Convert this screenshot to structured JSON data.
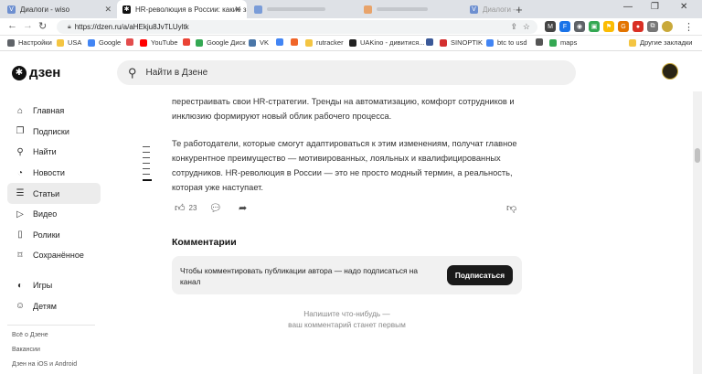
{
  "browser": {
    "tabs": [
      {
        "title": "Диалоги - wiso",
        "fav_color": "#6d8fd0",
        "fav_glyph": "V",
        "active": false
      },
      {
        "title": "HR-революция в России: какие з",
        "fav_color": "#111111",
        "fav_glyph": "✱",
        "active": true
      },
      {
        "title": "",
        "fav_color": "#7a9cd8",
        "fav_glyph": "",
        "active": false
      },
      {
        "title": "",
        "fav_color": "#e8a36a",
        "fav_glyph": "",
        "active": false
      },
      {
        "title": "Диалоги - wiso",
        "fav_color": "#6d8fd0",
        "fav_glyph": "V",
        "active": false
      }
    ],
    "url": "https://dzen.ru/a/aHEkju8JvTLUyltk",
    "bookmarks": [
      {
        "label": "Настройки",
        "color": "#5f6368"
      },
      {
        "label": "USA",
        "color": "#f4c542"
      },
      {
        "label": "Google",
        "color": "#4285f4"
      },
      {
        "label": "",
        "color": "#e34d4d"
      },
      {
        "label": "YouTube",
        "color": "#ff0000"
      },
      {
        "label": "",
        "color": "#ea4335"
      },
      {
        "label": "Google Диск",
        "color": "#34a853"
      },
      {
        "label": "VK",
        "color": "#4a76a8"
      },
      {
        "label": "",
        "color": "#4285f4"
      },
      {
        "label": "",
        "color": "#f06529"
      },
      {
        "label": "rutracker",
        "color": "#f4c542"
      },
      {
        "label": "UAKino - дивитися...",
        "color": "#222222"
      },
      {
        "label": "",
        "color": "#3b5998"
      },
      {
        "label": "SINOPTIK",
        "color": "#d32f2f"
      },
      {
        "label": "btc to usd",
        "color": "#4285f4"
      },
      {
        "label": "",
        "color": "#555555"
      },
      {
        "label": "maps",
        "color": "#34a853"
      }
    ],
    "other_bookmarks": "Другие закладки"
  },
  "dzen": {
    "logo_text": "дзен",
    "search_placeholder": "Найти в Дзене",
    "sidebar": {
      "items": [
        {
          "label": "Главная",
          "icon": "home-icon",
          "glyph": "⌂"
        },
        {
          "label": "Подписки",
          "icon": "subscriptions-icon",
          "glyph": "❐"
        },
        {
          "label": "Найти",
          "icon": "search-icon",
          "glyph": "⚲"
        },
        {
          "label": "Новости",
          "icon": "news-icon",
          "glyph": "◔"
        },
        {
          "label": "Статьи",
          "icon": "articles-icon",
          "glyph": "☰",
          "active": true
        },
        {
          "label": "Видео",
          "icon": "video-icon",
          "glyph": "▷"
        },
        {
          "label": "Ролики",
          "icon": "shorts-icon",
          "glyph": "▯"
        },
        {
          "label": "Сохранённое",
          "icon": "bookmark-icon",
          "glyph": "⌑"
        }
      ],
      "items2": [
        {
          "label": "Игры",
          "icon": "games-icon",
          "glyph": "◐"
        },
        {
          "label": "Детям",
          "icon": "kids-icon",
          "glyph": "☺"
        }
      ],
      "footer_links": [
        "Всё о Дзене",
        "Вакансии",
        "Дзен на iOS и Android"
      ]
    },
    "article": {
      "para1": "перестраивать свои HR-стратегии. Тренды на автоматизацию, комфорт сотрудников и инклюзию формируют новый облик рабочего процесса.",
      "para2": "Те работодатели, которые смогут адаптироваться к этим изменениям, получат главное конкурентное преимущество — мотивированных, лояльных и квалифицированных сотрудников. HR-революция в России — это не просто модный термин, а реальность, которая уже наступает.",
      "likes": "23"
    },
    "comments": {
      "title": "Комментарии",
      "notice": "Чтобы комментировать публикации автора — надо подписаться на канал",
      "subscribe_label": "Подписаться",
      "empty_line1": "Напишите что-нибудь —",
      "empty_line2": "ваш комментарий станет первым"
    }
  }
}
